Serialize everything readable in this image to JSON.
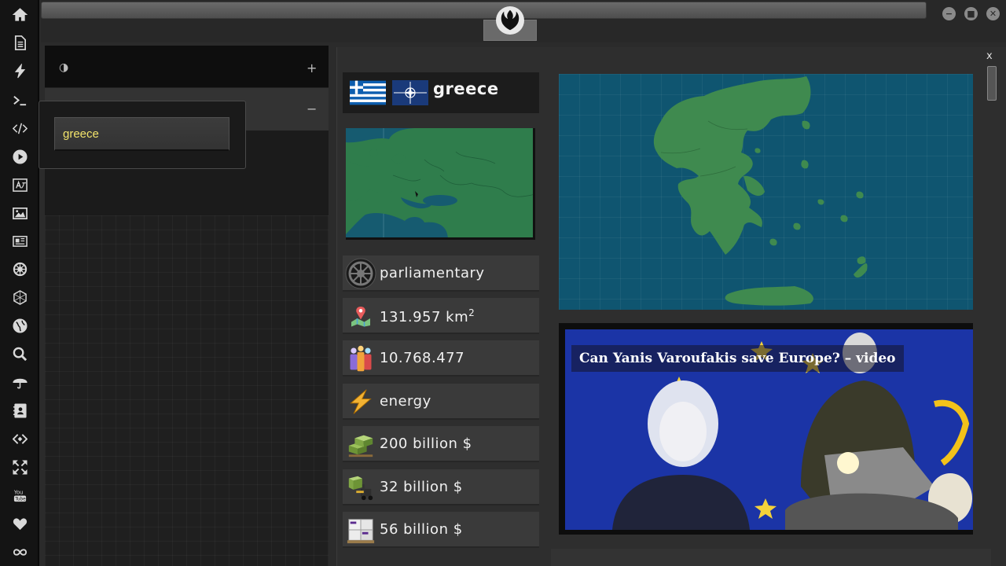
{
  "sidebar": {
    "icons": [
      "home-icon",
      "document-icon",
      "lightning-icon",
      "terminal-icon",
      "code-icon",
      "play-icon",
      "translate-icon",
      "image-icon",
      "newspaper-icon",
      "empire-icon",
      "hexagon-icon",
      "globe-icon",
      "search-icon",
      "umbrella-icon",
      "contacts-icon",
      "diamond-code-icon",
      "expand-icon",
      "youtube-icon",
      "heart-icon",
      "infinity-icon"
    ]
  },
  "search": {
    "value": "greece"
  },
  "country": {
    "name": "greece",
    "government": "parliamentary",
    "area_value": "131.957 km",
    "area_sup": "2",
    "population": "10.768.477",
    "energy": "energy",
    "gdp": "200 billion $",
    "imports": "32 billion $",
    "exports": "56 billion $"
  },
  "news": {
    "title": "Can Yanis Varoufakis save Europe? – video"
  },
  "window": {
    "close_label": "x"
  },
  "colors": {
    "land": "#3f8a4f",
    "sea": "#0f5570",
    "accent_text": "#f2e36b"
  }
}
